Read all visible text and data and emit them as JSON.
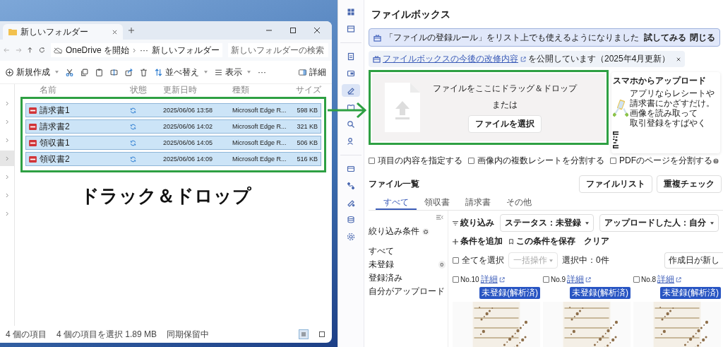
{
  "explorer": {
    "tab_title": "新しいフォルダー",
    "address": {
      "location": "OneDrive を開始",
      "overflow": "···",
      "folder": "新しいフォルダー"
    },
    "search": {
      "placeholder": "新しいフォルダーの検索"
    },
    "toolbar": {
      "new": "新規作成",
      "sort": "並べ替え",
      "view": "表示",
      "more": "···",
      "details": "詳細"
    },
    "columns": [
      "名前",
      "状態",
      "更新日時",
      "種類",
      "サイズ"
    ],
    "nav_rows": [
      {
        "selected": false
      },
      {
        "selected": false
      },
      {
        "selected": false
      },
      {
        "selected": true
      },
      {
        "selected": false
      },
      {
        "selected": false
      },
      {
        "selected": false
      }
    ],
    "files": [
      {
        "name": "請求書1",
        "modified": "2025/06/06 13:58",
        "type": "Microsoft Edge R...",
        "size": "598 KB",
        "selected": true
      },
      {
        "name": "請求書2",
        "modified": "2025/06/06 14:02",
        "type": "Microsoft Edge R...",
        "size": "321 KB",
        "selected": true
      },
      {
        "name": "領収書1",
        "modified": "2025/06/06 14:05",
        "type": "Microsoft Edge R...",
        "size": "506 KB",
        "selected": true
      },
      {
        "name": "領収書2",
        "modified": "2025/06/06 14:09",
        "type": "Microsoft Edge R...",
        "size": "516 KB",
        "selected": true
      }
    ],
    "status_bar": {
      "count": "4 個の項目",
      "selection": "4 個の項目を選択  1.89 MB",
      "sync": "同期保留中"
    },
    "view_buttons": [
      {
        "selected": true
      },
      {
        "selected": false
      }
    ]
  },
  "annotation": {
    "label": "ドラック＆ドロップ"
  },
  "app": {
    "rail": [
      {
        "selected": false
      },
      {
        "selected": false
      },
      {
        "selected": false
      },
      {
        "selected": false
      },
      {
        "selected": true
      },
      {
        "selected": false
      },
      {
        "selected": false
      },
      {
        "selected": false
      },
      {
        "selected": false
      },
      {
        "selected": false
      },
      {
        "selected": false
      },
      {
        "selected": false
      },
      {
        "selected": false
      }
    ],
    "title": "ファイルボックス",
    "banner": {
      "text": "「ファイルの登録ルール」をリスト上でも使えるようになりました",
      "actions": [
        "試してみる",
        "閉じる"
      ]
    },
    "notice": {
      "link": "ファイルボックスの今後の改修内容",
      "text": "を公開しています（2025年4月更新）"
    },
    "dropzone": {
      "hint": "ファイルをここにドラッグ＆ドロップ",
      "or": "または",
      "button": "ファイルを選択"
    },
    "promo": {
      "title": "スマホからアップロード",
      "lines": [
        "アプリならレシートや",
        "請求書にかざすだけ。",
        "画像を読み取って",
        "取引登録をすばやく"
      ]
    },
    "options": [
      {
        "label": "項目の内容を指定する",
        "checked": false
      },
      {
        "label": "画像内の複数レシートを分割する",
        "checked": false
      },
      {
        "label": "PDFのページを分割する",
        "checked": false
      }
    ],
    "list_title": "ファイル一覧",
    "list_buttons": [
      "ファイルリスト",
      "重複チェック"
    ],
    "tabs": [
      {
        "label": "すべて",
        "selected": true
      },
      {
        "label": "領収書",
        "selected": false
      },
      {
        "label": "請求書",
        "selected": false
      },
      {
        "label": "その他",
        "selected": false
      }
    ],
    "filter_panel": {
      "title": "絞り込み条件",
      "items": [
        {
          "label": "すべて"
        },
        {
          "label": "未登録",
          "count": "0"
        },
        {
          "label": "登録済み"
        },
        {
          "label": "自分がアップロード"
        }
      ]
    },
    "filters": {
      "label": "絞り込み",
      "dropdowns": [
        "ステータス：未登録",
        "アップロードした人：自分"
      ],
      "add": "条件を追加",
      "save": "この条件を保存",
      "clear": "クリア"
    },
    "bulk": {
      "select_all": "全てを選択",
      "checked": false,
      "action": "一括操作",
      "disabled": true,
      "selected_count": "選択中：0件",
      "sort": "作成日が新し"
    },
    "cards": [
      {
        "number": "No.10",
        "link": "詳細",
        "badge": "未登録(解析済)",
        "checked": false
      },
      {
        "number": "No.9",
        "link": "詳細",
        "badge": "未登録(解析済)",
        "checked": false
      },
      {
        "number": "No.8",
        "link": "詳細",
        "badge": "未登録(解析済)",
        "checked": false
      }
    ]
  }
}
